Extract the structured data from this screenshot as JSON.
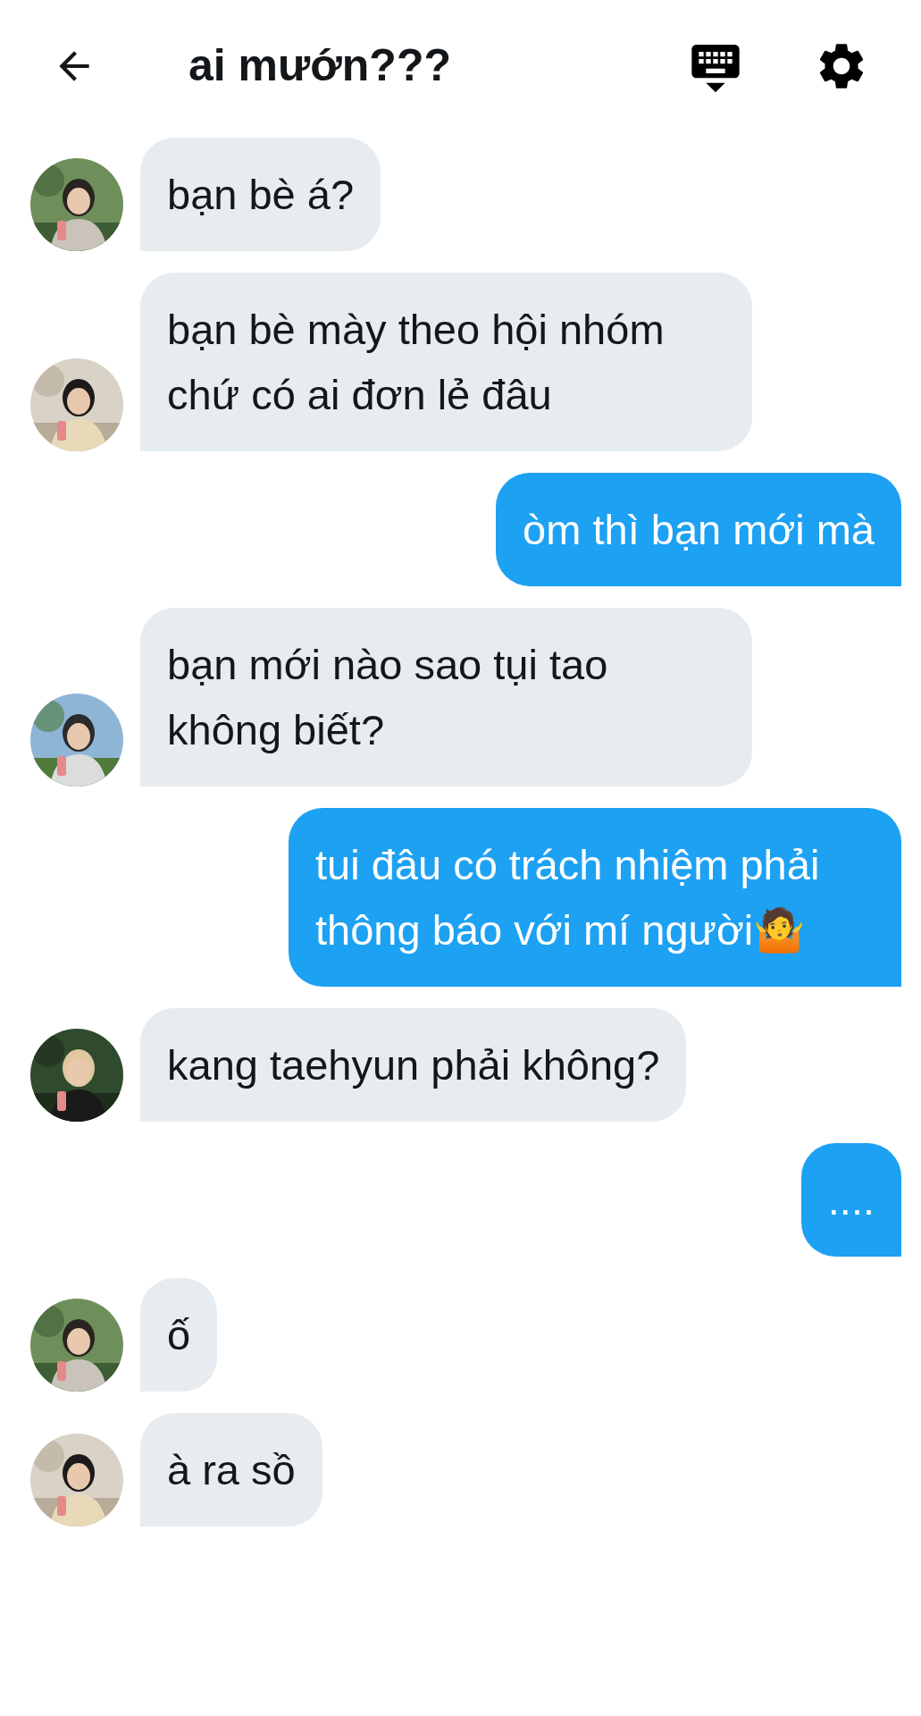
{
  "header": {
    "title": "ai mướn???"
  },
  "messages": [
    {
      "kind": "received",
      "text": "bạn bè á?"
    },
    {
      "kind": "received",
      "text": "bạn bè mày theo hội nhóm chứ có ai đơn lẻ đâu"
    },
    {
      "kind": "sent",
      "text": "òm thì bạn mới mà"
    },
    {
      "kind": "received",
      "text": "bạn mới nào sao tụi tao không biết?"
    },
    {
      "kind": "sent",
      "text": "tui đâu có trách nhiệm phải thông báo với mí người🤷"
    },
    {
      "kind": "received",
      "text": "kang taehyun phải không?"
    },
    {
      "kind": "sent",
      "text": "...."
    },
    {
      "kind": "received",
      "text": "ố"
    },
    {
      "kind": "received",
      "text": "à ra sồ"
    }
  ]
}
